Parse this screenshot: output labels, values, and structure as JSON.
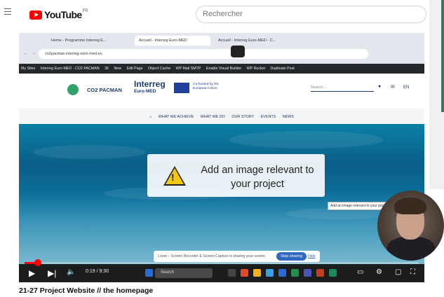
{
  "youtube": {
    "logo_text": "YouTube",
    "country_code": "FR",
    "search_placeholder": "Rechercher"
  },
  "browser": {
    "tabs": [
      {
        "label": "Home - Programme Interreg E..."
      },
      {
        "label": "Accueil - Interreg Euro-MED"
      },
      {
        "label": "Accueil - Interreg Euro-MED - C..."
      }
    ],
    "url": "co2pacman.interreg-euro-med.eu"
  },
  "wp_admin_bar": {
    "items": [
      "My Sites",
      "Interreg Euro-MED - CO2 PACMAN",
      "36",
      "New",
      "Edit Page",
      "Object Cache",
      "WP Mail SMTP",
      "Enable Visual Builder",
      "WP Rocket",
      "Duplicate Post"
    ]
  },
  "site": {
    "project_name": "CO2 PACMAN",
    "program_name": "Interreg",
    "program_sub": "Euro-MED",
    "cofunded": "Co-funded by the European Union",
    "search_placeholder": "Search...",
    "language": "EN",
    "nav": [
      "WHAT WE ACHIEVE",
      "WHAT WE DO",
      "OUR STORY",
      "EVENTS",
      "NEWS"
    ],
    "hero_notice": "Add an image relevant to your project",
    "tooltip": "Add an image relevant to your project"
  },
  "loom": {
    "message": "Loom – Screen Recorder & Screen Capture is sharing your screen.",
    "stop_label": "Stop sharing",
    "hide_label": "Hide"
  },
  "player": {
    "time": "0:19 / 9:30",
    "taskbar_search": "Search",
    "progress_fraction": 0.034
  },
  "video_title": "21-27 Project Website // the homepage",
  "colors": {
    "youtube_red": "#ff0000",
    "wp_bar": "#23282d",
    "loom_blue": "#2e68c0"
  }
}
